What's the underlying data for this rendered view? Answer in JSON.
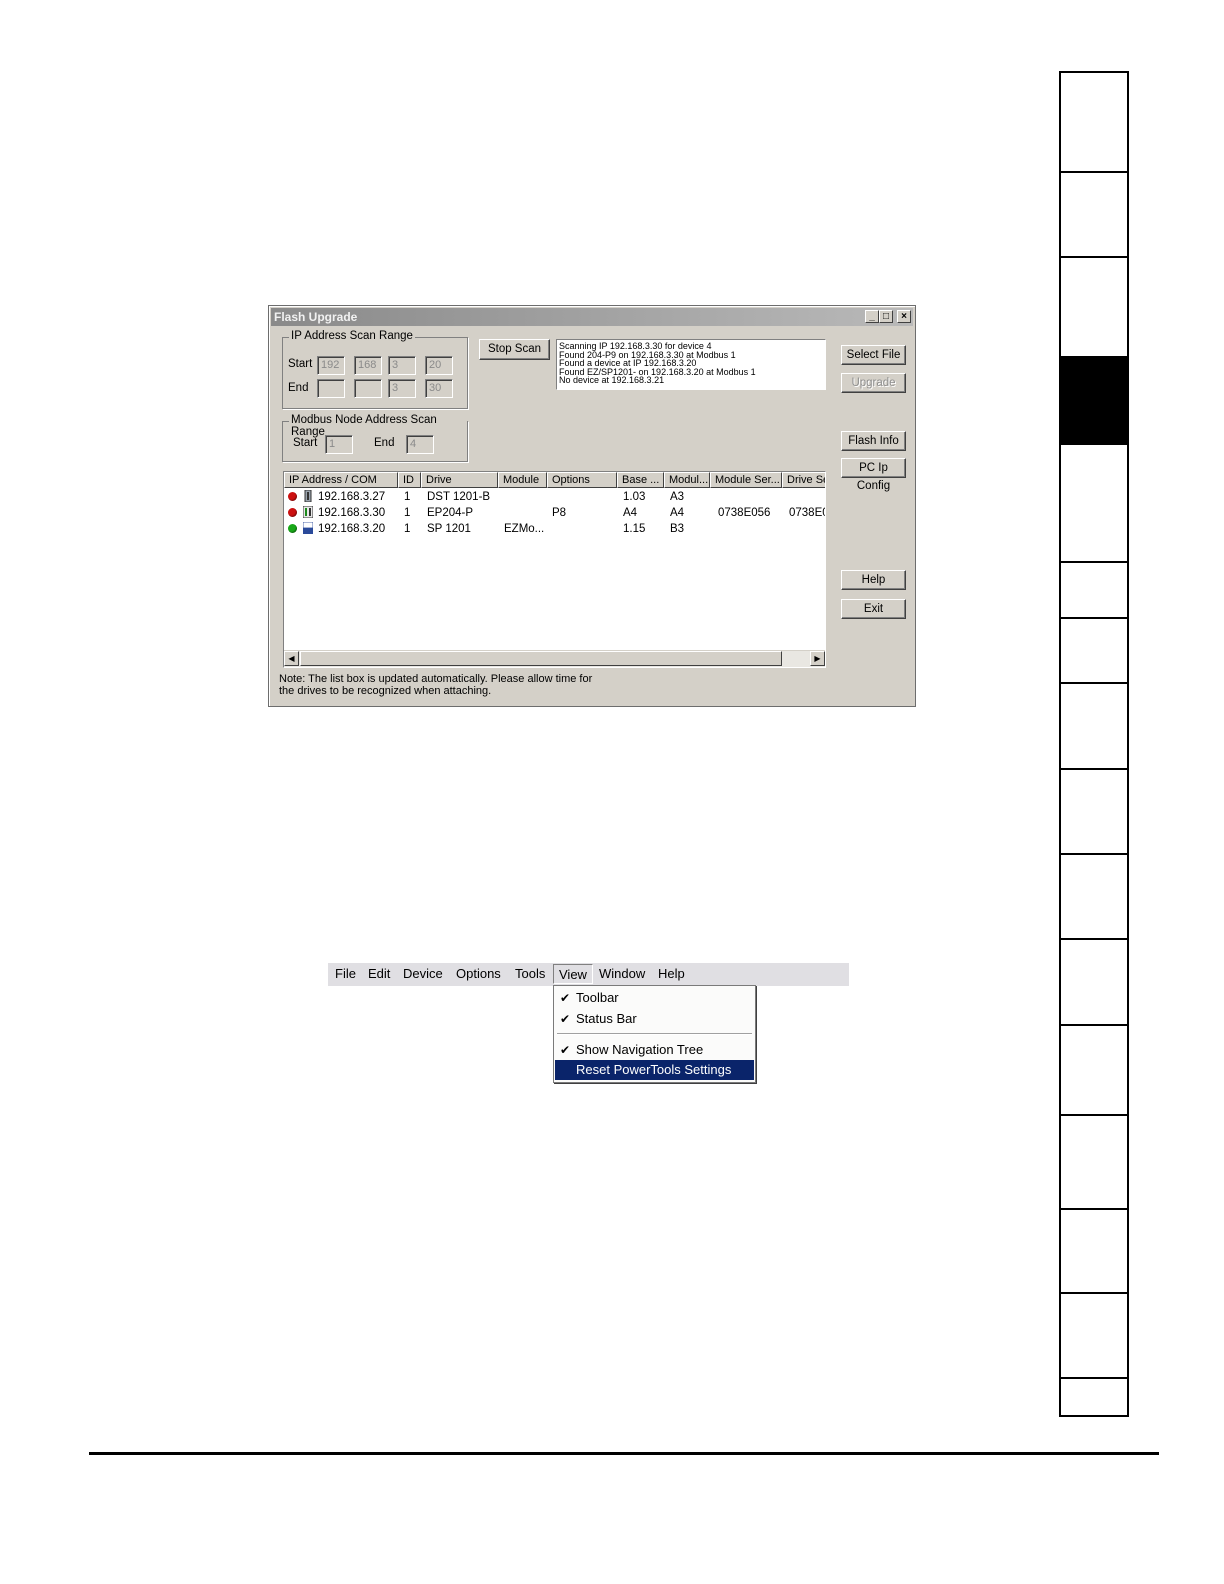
{
  "flash_window": {
    "title": "Flash Upgrade",
    "controls": {
      "minimize": "_",
      "maximize": "□",
      "close": "×"
    },
    "ip_scan": {
      "legend": "IP Address Scan Range",
      "start_label": "Start",
      "end_label": "End",
      "start": [
        "192",
        "168",
        "3",
        "20"
      ],
      "end": [
        "",
        "",
        "3",
        "30"
      ]
    },
    "modbus_scan": {
      "legend": "Modbus Node Address Scan Range",
      "start_label": "Start",
      "end_label": "End",
      "start": "1",
      "end": "4"
    },
    "stop_scan_label": "Stop Scan",
    "log_lines": [
      "Scanning IP 192.168.3.30 for device 4",
      "Found 204-P9 on 192.168.3.30 at Modbus 1",
      "Found a device at IP 192.168.3.20",
      "Found EZ/SP1201- on 192.168.3.20 at Modbus 1",
      "No device at 192.168.3.21"
    ],
    "buttons": {
      "select_file": "Select File",
      "upgrade": "Upgrade",
      "flash_info": "Flash Info",
      "pc_ip_config": "PC Ip Config",
      "help": "Help",
      "exit": "Exit"
    },
    "table": {
      "columns": [
        "IP Address / COM",
        "ID",
        "Drive",
        "Module",
        "Options",
        "Base ...",
        "Modul...",
        "Module Ser...",
        "Drive Se"
      ],
      "rows": [
        {
          "status": "#cc1010",
          "ip": "192.168.3.27",
          "id": "1",
          "drive": "DST 1201-B",
          "module": "",
          "options": "",
          "base": "1.03",
          "modul": "A3",
          "module_ser": "",
          "drive_ser": ""
        },
        {
          "status": "#cc1010",
          "ip": "192.168.3.30",
          "id": "1",
          "drive": "EP204-P",
          "module": "",
          "options": "P8",
          "base": "A4",
          "modul": "A4",
          "module_ser": "0738E056",
          "drive_ser": "0738E0"
        },
        {
          "status": "#18a818",
          "ip": "192.168.3.20",
          "id": "1",
          "drive": "SP 1201",
          "module": "EZMo...",
          "options": "",
          "base": "1.15",
          "modul": "B3",
          "module_ser": "",
          "drive_ser": ""
        }
      ]
    },
    "note": "Note: The list box is updated automatically.  Please allow time for the drives to be recognized when attaching."
  },
  "menu": {
    "bar": [
      "File",
      "Edit",
      "Device",
      "Options",
      "Tools",
      "View",
      "Window",
      "Help"
    ],
    "open_menu": "View",
    "items": [
      {
        "label": "Toolbar",
        "checked": "✔"
      },
      {
        "label": "Status Bar",
        "checked": "✔"
      },
      {
        "label": "Show Navigation Tree",
        "checked": "✔"
      },
      {
        "label": "Reset PowerTools Settings",
        "checked": ""
      }
    ],
    "highlight_color": "#0a246a"
  }
}
